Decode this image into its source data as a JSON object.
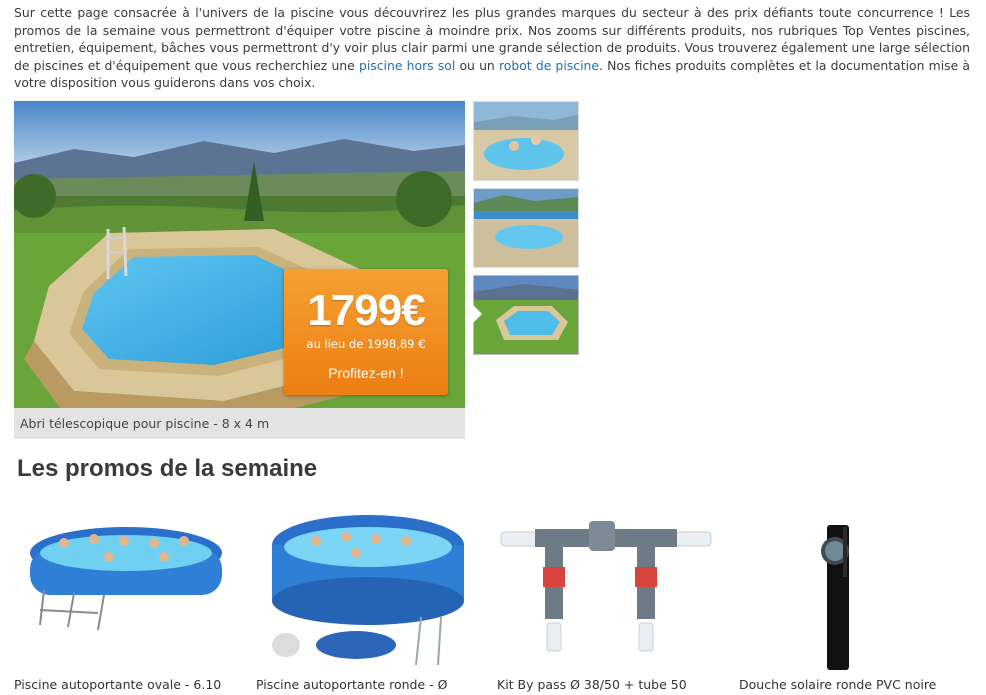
{
  "intro": {
    "text_1": "Sur cette page consacrée à l'univers de la piscine vous découvrirez les plus grandes marques du secteur à des prix défiants toute concurrence ! Les promos de la semaine vous permettront d'équiper votre piscine à moindre prix. Nos zooms sur différents produits, nos rubriques Top Ventes piscines, entretien, équipement, bâches vous permettront d'y voir plus clair parmi une grande sélection de produits. Vous trouverez également une large sélection de piscines et d'équipement que vous recherchiez une ",
    "link_1": "piscine hors sol",
    "text_2": " ou un ",
    "link_2": "robot de piscine",
    "text_3": ". Nos fiches produits complètes et la documentation mise à votre disposition vous guiderons dans vos choix."
  },
  "slider": {
    "price": "1799€",
    "old_price": "au lieu de 1998,89 €",
    "cta": "Profitez-en !",
    "caption": "Abri télescopique pour piscine - 8 x 4 m"
  },
  "promos": {
    "title": "Les promos de la semaine",
    "products": [
      {
        "name": "Piscine autoportante ovale - 6.10"
      },
      {
        "name": "Piscine autoportante ronde - Ø"
      },
      {
        "name": "Kit By pass Ø 38/50 + tube 50"
      },
      {
        "name": "Douche solaire ronde PVC noire"
      }
    ]
  },
  "colors": {
    "accent_orange": "#ec7e12",
    "link_blue": "#1f6fb2",
    "caption_bg": "#e3e3e3"
  }
}
